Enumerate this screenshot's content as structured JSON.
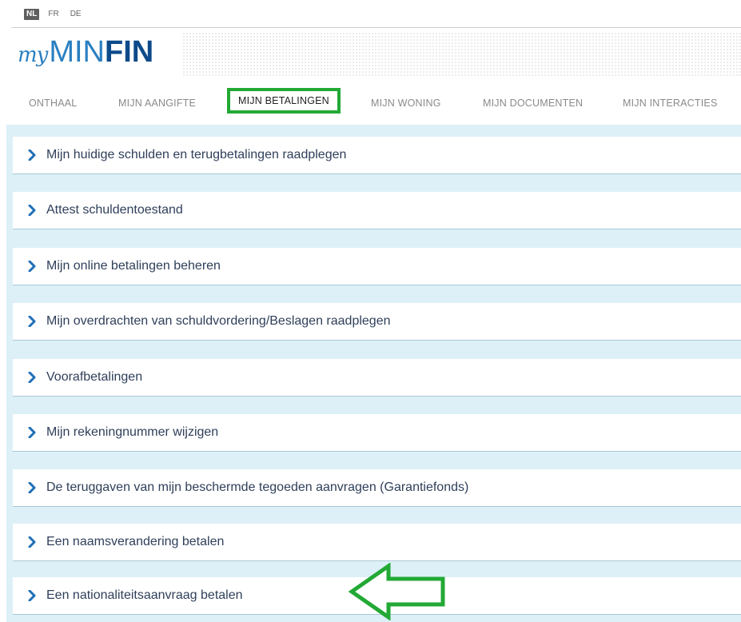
{
  "languages": [
    {
      "code": "NL",
      "active": true
    },
    {
      "code": "FR",
      "active": false
    },
    {
      "code": "DE",
      "active": false
    }
  ],
  "logo": {
    "my": "my",
    "min": "MIN",
    "fin": "FIN"
  },
  "nav": [
    {
      "label": "ONTHAAL"
    },
    {
      "label": "MIJN AANGIFTE"
    },
    {
      "label": "MIJN BETALINGEN"
    },
    {
      "label": "MIJN WONING"
    },
    {
      "label": "MIJN DOCUMENTEN"
    },
    {
      "label": "MIJN INTERACTIES"
    }
  ],
  "colors": {
    "highlight": "#22a935",
    "link_text": "#2f3f5a",
    "chevron": "#1f6fb5",
    "panel_bg": "#ddf0f8"
  },
  "menu_items": [
    {
      "label": "Mijn huidige schulden en terugbetalingen raadplegen",
      "icon": "chevron-right-icon"
    },
    {
      "label": "Attest schuldentoestand",
      "icon": "chevron-right-icon"
    },
    {
      "label": "Mijn online betalingen beheren",
      "icon": "chevron-right-icon"
    },
    {
      "label": "Mijn overdrachten van schuldvordering/Beslagen raadplegen",
      "icon": "chevron-right-icon"
    },
    {
      "label": "Voorafbetalingen",
      "icon": "chevron-right-icon"
    },
    {
      "label": "Mijn rekeningnummer wijzigen",
      "icon": "chevron-right-icon"
    },
    {
      "label": "De teruggaven van mijn beschermde tegoeden aanvragen (Garantiefonds)",
      "icon": "chevron-right-icon"
    },
    {
      "label": "Een naamsverandering betalen",
      "icon": "chevron-right-icon"
    },
    {
      "label": "Een nationaliteitsaanvraag betalen",
      "icon": "chevron-right-icon"
    }
  ]
}
